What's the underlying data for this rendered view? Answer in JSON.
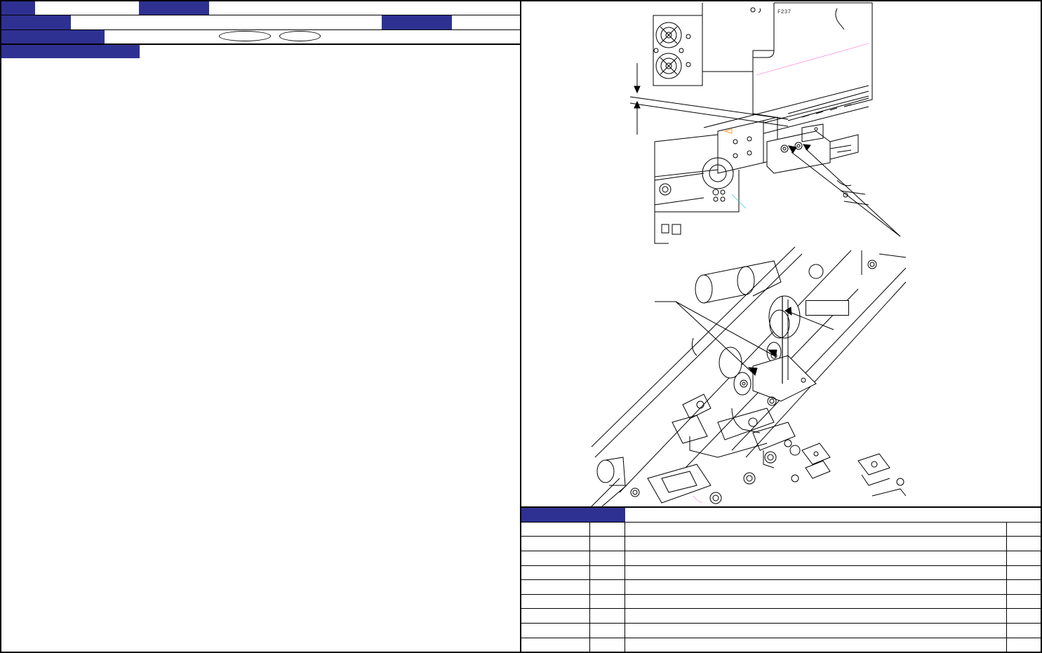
{
  "header": {
    "row1": {
      "navy_cell_1": "",
      "field_1": "",
      "navy_cell_2": "",
      "field_2": ""
    },
    "row2": {
      "navy_cell_1": "",
      "field_1": "",
      "navy_cell_2": "",
      "field_2": ""
    },
    "row3": {
      "navy_cell_1": "",
      "field_1": "",
      "option_1": "",
      "option_2": ""
    }
  },
  "left_panel": {
    "section_tab": "",
    "body_text": ""
  },
  "figure": {
    "part_label": "F237",
    "callout_box": "",
    "colors": {
      "line": "#000000",
      "accent_pink": "#ff66cc",
      "accent_cyan": "#33cccc",
      "accent_orange": "#ff9933"
    }
  },
  "parts_table": {
    "header_tab": "",
    "rows": [
      {
        "col1": "",
        "col2": "",
        "col3": "",
        "col4": ""
      },
      {
        "col1": "",
        "col2": "",
        "col3": "",
        "col4": ""
      },
      {
        "col1": "",
        "col2": "",
        "col3": "",
        "col4": ""
      },
      {
        "col1": "",
        "col2": "",
        "col3": "",
        "col4": ""
      },
      {
        "col1": "",
        "col2": "",
        "col3": "",
        "col4": ""
      },
      {
        "col1": "",
        "col2": "",
        "col3": "",
        "col4": ""
      },
      {
        "col1": "",
        "col2": "",
        "col3": "",
        "col4": ""
      },
      {
        "col1": "",
        "col2": "",
        "col3": "",
        "col4": ""
      }
    ]
  }
}
